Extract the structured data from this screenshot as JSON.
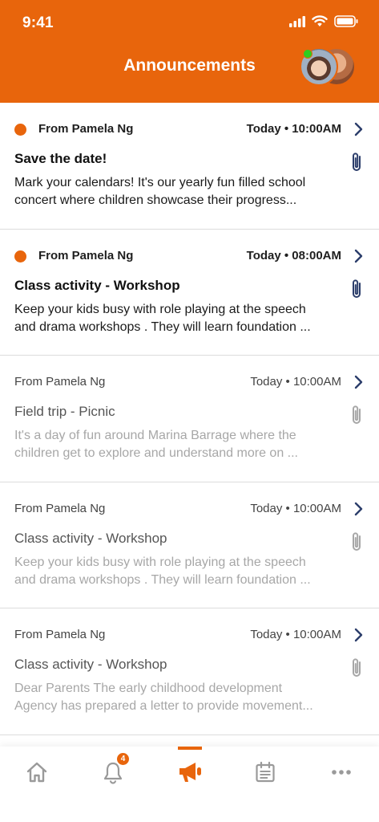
{
  "status_bar": {
    "time": "9:41"
  },
  "header": {
    "title": "Announcements"
  },
  "announcements": [
    {
      "sender": "From Pamela Ng",
      "time": "Today • 10:00AM",
      "title": "Save the date!",
      "preview_line1": "Mark your calendars! It's our yearly fun filled school",
      "preview_line2": "concert where children showcase their progress...",
      "unread": true
    },
    {
      "sender": "From Pamela Ng",
      "time": "Today • 08:00AM",
      "title": "Class activity - Workshop",
      "preview_line1": "Keep your kids busy with role playing at the speech",
      "preview_line2": "and drama workshops . They will learn foundation ...",
      "unread": true
    },
    {
      "sender": "From Pamela Ng",
      "time": "Today • 10:00AM",
      "title": "Field trip - Picnic",
      "preview_line1": "It's a day of fun around Marina Barrage where the",
      "preview_line2": "children get to explore and understand more on ...",
      "unread": false
    },
    {
      "sender": "From Pamela Ng",
      "time": "Today • 10:00AM",
      "title": "Class activity - Workshop",
      "preview_line1": "Keep your kids busy with role playing at the speech",
      "preview_line2": "and drama workshops . They will learn foundation ...",
      "unread": false
    },
    {
      "sender": "From Pamela Ng",
      "time": "Today • 10:00AM",
      "title": "Class activity - Workshop",
      "preview_line1": "Dear Parents The early childhood development",
      "preview_line2": "Agency  has prepared a letter to provide movement...",
      "unread": false
    }
  ],
  "tabbar": {
    "notifications_badge": "4",
    "active_tab": "announcements",
    "icons": [
      "home-icon",
      "bell-icon",
      "megaphone-icon",
      "calendar-icon",
      "more-icon"
    ]
  },
  "colors": {
    "accent": "#e8650c",
    "online": "#2ecc1f",
    "icon_gray": "#9a9a9a",
    "chevron": "#2c3e6b"
  }
}
